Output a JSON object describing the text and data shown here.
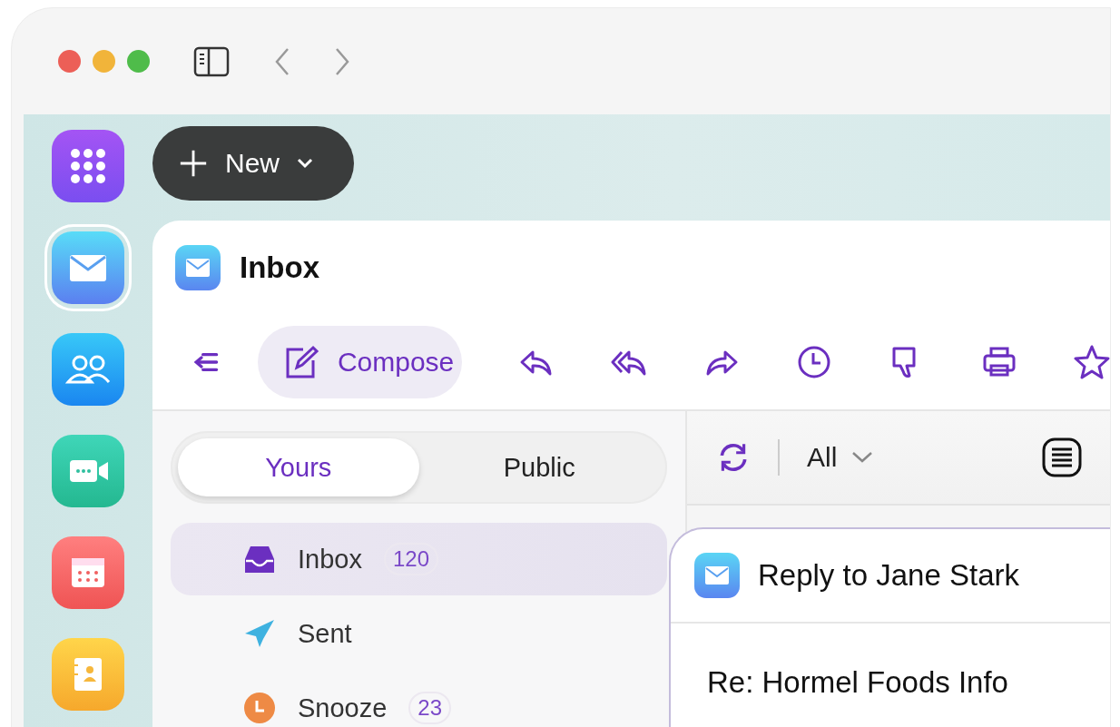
{
  "window": {
    "controls": [
      {
        "color": "#ec5f57"
      },
      {
        "color": "#f1b43a"
      },
      {
        "color": "#4fbc4a"
      }
    ]
  },
  "app_rail": [
    {
      "kind": "apps",
      "selected": false
    },
    {
      "kind": "mail",
      "selected": true
    },
    {
      "kind": "contacts",
      "selected": false
    },
    {
      "kind": "video",
      "selected": false
    },
    {
      "kind": "calendar",
      "selected": false
    },
    {
      "kind": "notes",
      "selected": false
    }
  ],
  "new_button": {
    "label": "New"
  },
  "panel": {
    "title": "Inbox"
  },
  "toolbar": {
    "compose_label": "Compose",
    "actions": [
      {
        "kind": "reply"
      },
      {
        "kind": "reply_all"
      },
      {
        "kind": "forward"
      },
      {
        "kind": "snooze"
      },
      {
        "kind": "spam"
      },
      {
        "kind": "print"
      },
      {
        "kind": "star"
      }
    ]
  },
  "folder_tabs": [
    {
      "label": "Yours",
      "selected": true
    },
    {
      "label": "Public",
      "selected": false
    }
  ],
  "folders": [
    {
      "kind": "inbox",
      "label": "Inbox",
      "count": "120",
      "selected": true
    },
    {
      "kind": "sent",
      "label": "Sent",
      "selected": false
    },
    {
      "kind": "snooze",
      "label": "Snooze",
      "count": "23",
      "selected": false
    }
  ],
  "message_list": {
    "filter": "All"
  },
  "compose_window": {
    "title": "Reply to Jane Stark",
    "subject": "Re: Hormel Foods Info"
  }
}
